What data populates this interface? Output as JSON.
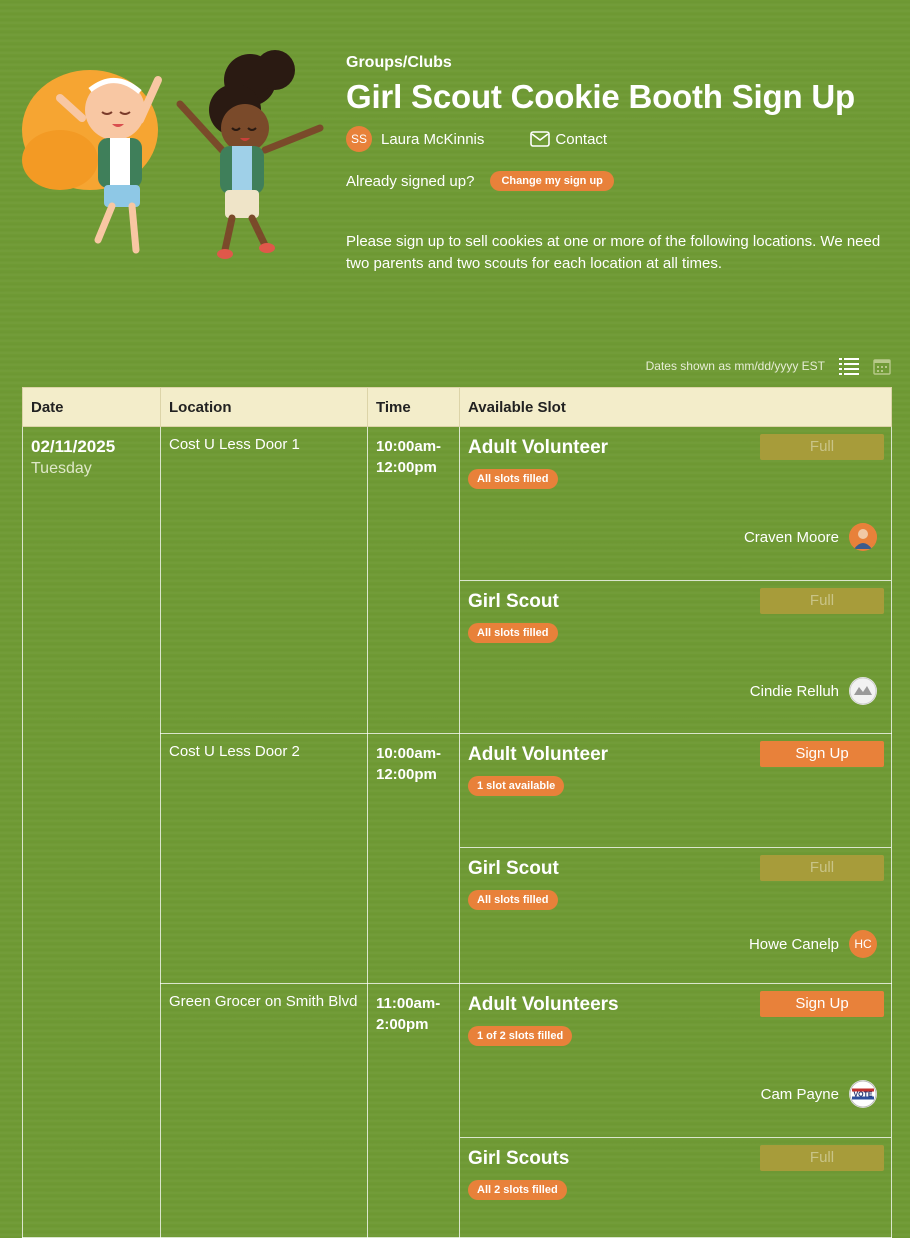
{
  "header": {
    "category": "Groups/Clubs",
    "title": "Girl Scout Cookie Booth Sign Up",
    "organizer_initials": "SS",
    "organizer_name": "Laura McKinnis",
    "contact_label": "Contact",
    "already_signed_text": "Already signed up?",
    "change_signup_label": "Change my sign up",
    "description": "Please sign up to sell cookies at one or more of the following locations. We need two parents and two scouts for each location at all times."
  },
  "toolbar": {
    "dates_note": "Dates shown as mm/dd/yyyy EST",
    "list_view_icon": "list-icon",
    "calendar_view_icon": "calendar-icon"
  },
  "table": {
    "columns": [
      "Date",
      "Location",
      "Time",
      "Available Slot"
    ],
    "date": "02/11/2025",
    "weekday": "Tuesday",
    "locations": [
      {
        "name": "Cost U Less Door 1",
        "time_start": "10:00am-",
        "time_end": "12:00pm",
        "slots": [
          {
            "title": "Adult Volunteer",
            "status": "All slots filled",
            "button": "Full",
            "volunteer": "Craven Moore"
          },
          {
            "title": "Girl Scout",
            "status": "All slots filled",
            "button": "Full",
            "volunteer": "Cindie Relluh"
          }
        ]
      },
      {
        "name": "Cost U Less Door 2",
        "time_start": "10:00am-",
        "time_end": "12:00pm",
        "slots": [
          {
            "title": "Adult Volunteer",
            "status": "1 slot available",
            "button": "Sign Up",
            "volunteer": ""
          },
          {
            "title": "Girl Scout",
            "status": "All slots filled",
            "button": "Full",
            "volunteer": "Howe Canelp",
            "volunteer_initials": "HC"
          }
        ]
      },
      {
        "name": "Green Grocer on Smith Blvd",
        "time_start": "11:00am-",
        "time_end": "2:00pm",
        "slots": [
          {
            "title": "Adult Volunteers",
            "status": "1 of 2 slots filled",
            "button": "Sign Up",
            "volunteer": "Cam Payne",
            "volunteer_badge": "VOTE"
          },
          {
            "title": "Girl Scouts",
            "status": "All 2 slots filled",
            "button": "Full",
            "volunteer": ""
          }
        ]
      }
    ]
  },
  "colors": {
    "background": "#6f9a34",
    "accent": "#e8813a",
    "header_row": "#f3edca",
    "full_button": "#a79c3a"
  }
}
